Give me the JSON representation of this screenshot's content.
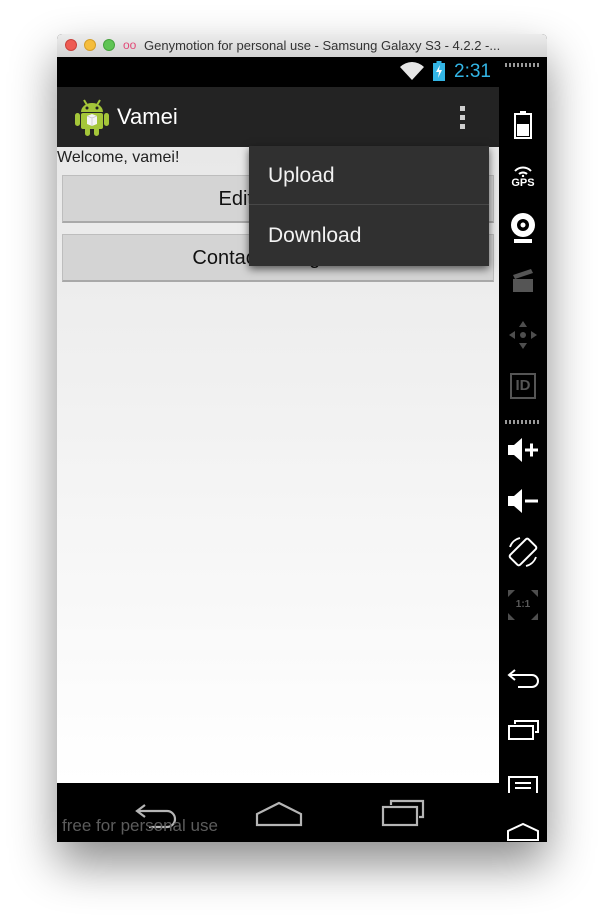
{
  "window": {
    "title": "Genymotion for personal use - Samsung Galaxy S3 - 4.2.2 -..."
  },
  "status_bar": {
    "time": "2:31"
  },
  "action_bar": {
    "title": "Vamei"
  },
  "content": {
    "welcome": "Welcome, vamei!",
    "buttons": [
      {
        "label": "Edit Contacts"
      },
      {
        "label": "Contact Categories"
      }
    ]
  },
  "overflow_menu": {
    "items": [
      {
        "label": "Upload"
      },
      {
        "label": "Download"
      }
    ]
  },
  "nav_bar": {
    "watermark": "free for personal use"
  },
  "sidebar": {
    "gps_label": "GPS",
    "id_label": "ID",
    "pixel_label": "1:1"
  },
  "colors": {
    "status_time": "#33b5e5",
    "action_bar_bg": "#232323",
    "menu_bg": "#303030",
    "button_bg": "#d4d4d4",
    "android_green": "#a4c639"
  },
  "icons": [
    "close-traffic-light",
    "minimize-traffic-light",
    "zoom-traffic-light",
    "genymotion-logo-icon",
    "wifi-icon",
    "battery-charging-icon",
    "android-icon",
    "overflow-menu-icon",
    "back-icon",
    "home-icon",
    "recent-apps-icon",
    "battery-icon",
    "gps-icon",
    "webcam-icon",
    "clapperboard-icon",
    "dpad-icon",
    "id-icon",
    "volume-up-icon",
    "volume-down-icon",
    "rotate-icon",
    "pixel-perfect-icon",
    "sidebar-back-icon",
    "sidebar-recent-icon",
    "sidebar-menu-icon",
    "sidebar-home-icon"
  ]
}
